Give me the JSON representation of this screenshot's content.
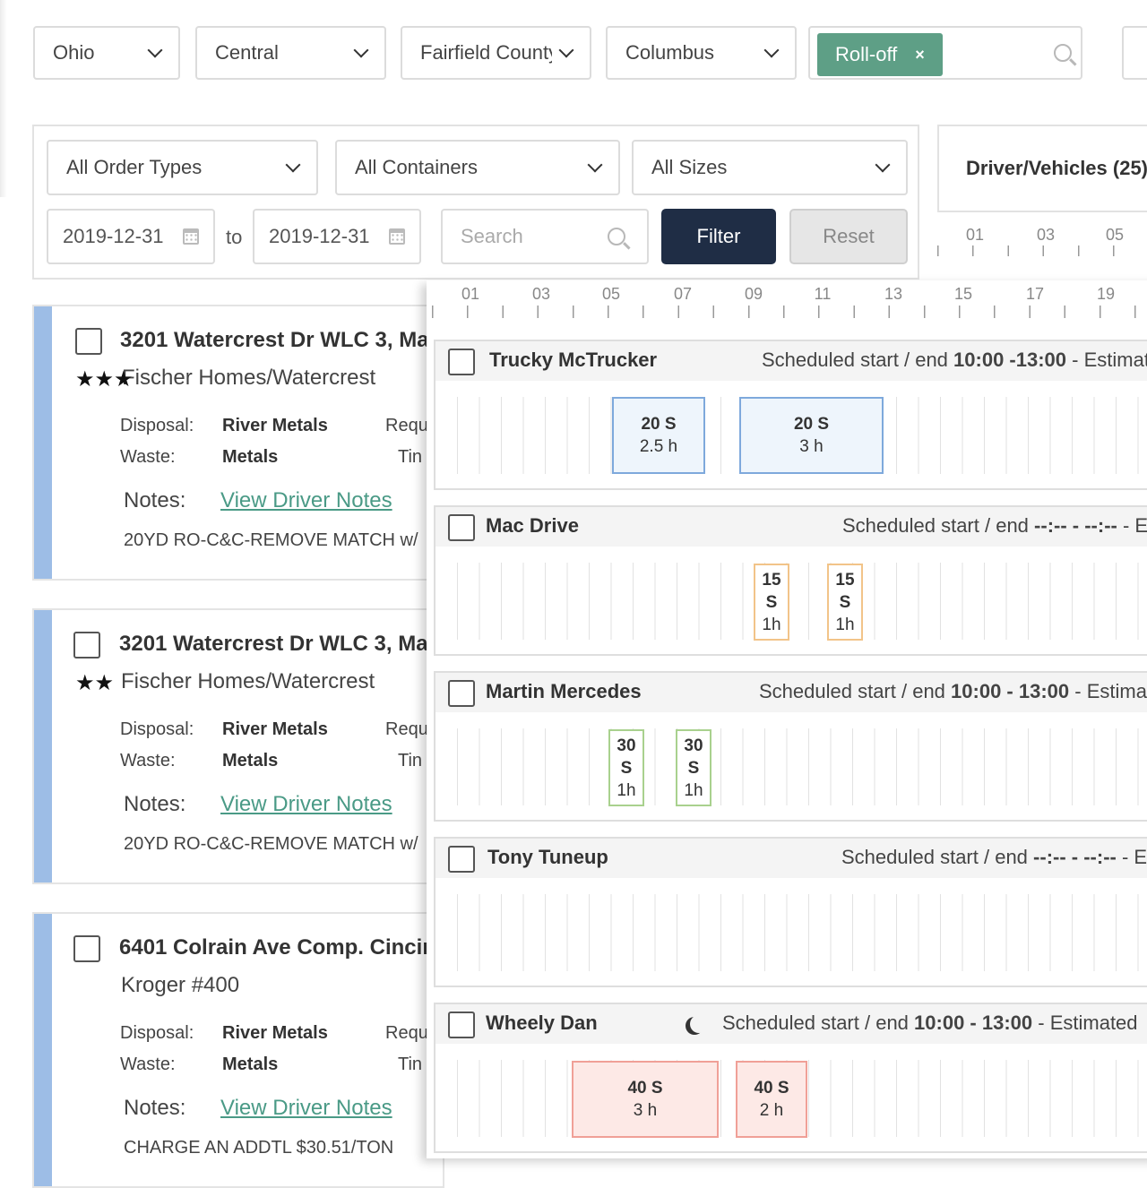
{
  "top_filters": {
    "state": "Ohio",
    "region": "Central",
    "county": "Fairfield County",
    "city": "Columbus",
    "tag": "Roll-off",
    "tag_remove": "×"
  },
  "filter_panel": {
    "order_types": "All Order Types",
    "containers": "All Containers",
    "sizes": "All Sizes",
    "date_from": "2019-12-31",
    "date_sep": "to",
    "date_to": "2019-12-31",
    "search_placeholder": "Search",
    "filter_label": "Filter",
    "reset_label": "Reset"
  },
  "driver_panel": {
    "title": "Driver/Vehicles (25)",
    "hours": [
      "01",
      "03",
      "05"
    ]
  },
  "orders": [
    {
      "address": "3201 Watercrest Dr WLC 3, Ma",
      "customer": "Fischer Homes/Watercrest",
      "stars": "★★★",
      "disposal_label": "Disposal:",
      "disposal": "River Metals",
      "req": "Requ",
      "waste_label": "Waste:",
      "waste": "Metals",
      "time": "Tin",
      "notes_label": "Notes:",
      "notes_link": "View Driver Notes",
      "description": "20YD RO-C&C-REMOVE MATCH w/"
    },
    {
      "address": "3201 Watercrest Dr WLC 3, Ma",
      "customer": "Fischer Homes/Watercrest",
      "stars": "★★",
      "disposal_label": "Disposal:",
      "disposal": "River Metals",
      "req": "Requ",
      "waste_label": "Waste:",
      "waste": "Metals",
      "time": "Tin",
      "notes_label": "Notes:",
      "notes_link": "View Driver Notes",
      "description": "20YD RO-C&C-REMOVE MATCH w/"
    },
    {
      "address": "6401 Colrain Ave Comp. Cincin",
      "customer": "Kroger #400",
      "stars": "",
      "disposal_label": "Disposal:",
      "disposal": "River Metals",
      "req": "Requ",
      "waste_label": "Waste:",
      "waste": "Metals",
      "time": "Tin",
      "notes_label": "Notes:",
      "notes_link": "View Driver Notes",
      "description": "CHARGE AN ADDTL $30.51/TON"
    }
  ],
  "timeline": {
    "hours": [
      "01",
      "03",
      "05",
      "07",
      "09",
      "11",
      "13",
      "15",
      "17",
      "19"
    ],
    "drivers": [
      {
        "name": "Trucky McTrucker",
        "schedule_prefix": "Scheduled start / end",
        "schedule_time": "10:00 -13:00",
        "schedule_suffix": "- Estimat",
        "jobs": [
          {
            "size": "20 S",
            "duration": "2.5 h"
          },
          {
            "size": "20 S",
            "duration": "3 h"
          }
        ]
      },
      {
        "name": "Mac Drive",
        "schedule_prefix": "Scheduled start / end",
        "schedule_time": "--:-- - --:--",
        "schedule_suffix": "- E",
        "jobs": [
          {
            "size": "15",
            "unit": "S",
            "duration": "1h"
          },
          {
            "size": "15",
            "unit": "S",
            "duration": "1h"
          }
        ]
      },
      {
        "name": "Martin Mercedes",
        "schedule_prefix": "Scheduled start / end",
        "schedule_time": "10:00 - 13:00",
        "schedule_suffix": "- Estima",
        "jobs": [
          {
            "size": "30",
            "unit": "S",
            "duration": "1h"
          },
          {
            "size": "30",
            "unit": "S",
            "duration": "1h"
          }
        ]
      },
      {
        "name": "Tony Tuneup",
        "schedule_prefix": "Scheduled start / end",
        "schedule_time": "--:-- - --:--",
        "schedule_suffix": "- E",
        "jobs": []
      },
      {
        "name": "Wheely Dan",
        "schedule_prefix": "Scheduled start / end",
        "schedule_time": "10:00 - 13:00",
        "schedule_suffix": "- Estimated",
        "jobs": [
          {
            "size": "40 S",
            "duration": "3 h"
          },
          {
            "size": "40 S",
            "duration": "2 h"
          }
        ]
      }
    ]
  },
  "colors": {
    "tag_green": "#5e9f86",
    "filter_navy": "#1f2d45",
    "order_bar_blue": "#9dbde6",
    "link_teal": "#4a9a86",
    "job_blue_border": "#7ea9dc",
    "job_blue_fill": "#eef5fc",
    "job_orange_border": "#f2c489",
    "job_green_border": "#a9d18e",
    "job_red_border": "#f0a097",
    "job_red_fill": "#fde9e6"
  }
}
